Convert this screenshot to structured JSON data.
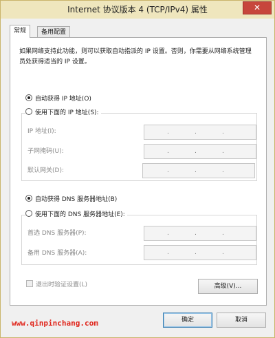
{
  "window": {
    "title": "Internet 协议版本 4 (TCP/IPv4) 属性",
    "close_label": "✕"
  },
  "tabs": [
    {
      "label": "常规"
    },
    {
      "label": "备用配置"
    }
  ],
  "description": "如果网络支持此功能，则可以获取自动指派的 IP 设置。否则，你需要从网络系统管理员处获得适当的 IP 设置。",
  "ip": {
    "auto_label": "自动获得 IP 地址(O)",
    "manual_label": "使用下面的 IP 地址(S):",
    "selected": "auto",
    "fields": [
      {
        "label": "IP 地址(I):",
        "value": " .  .  . "
      },
      {
        "label": "子网掩码(U):",
        "value": " .  .  . "
      },
      {
        "label": "默认网关(D):",
        "value": " .  .  . "
      }
    ]
  },
  "dns": {
    "auto_label": "自动获得 DNS 服务器地址(B)",
    "manual_label": "使用下面的 DNS 服务器地址(E):",
    "selected": "auto",
    "fields": [
      {
        "label": "首选 DNS 服务器(P):"
      },
      {
        "label": "备用 DNS 服务器(A):"
      }
    ]
  },
  "validate_on_exit_label": "退出时验证设置(L)",
  "advanced_label": "高级(V)...",
  "ok_label": "确定",
  "cancel_label": "取消",
  "watermark": "www.qinpinchang.com",
  "colors": {
    "title_bg": "#efe6bd",
    "close_bg": "#c7463c",
    "watermark": "#e0251b"
  }
}
